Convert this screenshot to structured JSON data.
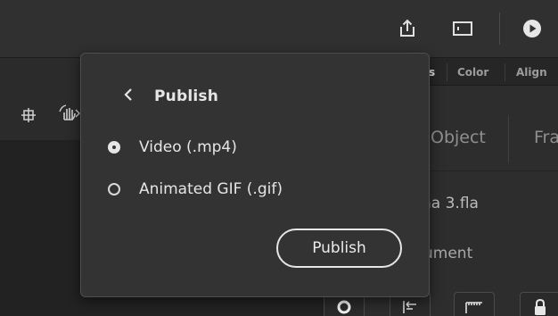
{
  "topbar": {
    "icons": [
      "share-icon",
      "panel-layout-icon",
      "play-icon"
    ]
  },
  "left_tools": {
    "icons": [
      "crosshair-icon",
      "hand-rotate-icon"
    ]
  },
  "panel": {
    "tabs": [
      {
        "label": "s",
        "active": true
      },
      {
        "label": "Color",
        "active": false
      },
      {
        "label": "Align",
        "active": false
      }
    ],
    "property_tabs": [
      "Object",
      "Fra"
    ],
    "document_name": "na 3.fla",
    "document_label": "ument",
    "tool_icons": [
      "pin-icon",
      "align-left-icon",
      "ruler-icon",
      "lock-icon"
    ]
  },
  "publish_popup": {
    "back_icon": "chevron-left-icon",
    "title": "Publish",
    "options": [
      {
        "label": "Video (.mp4)",
        "selected": true
      },
      {
        "label": "Animated GIF (.gif)",
        "selected": false
      }
    ],
    "button_label": "Publish"
  },
  "colors": {
    "background": "#262626",
    "popup_background": "#333333",
    "text": "#e6e6e6"
  }
}
